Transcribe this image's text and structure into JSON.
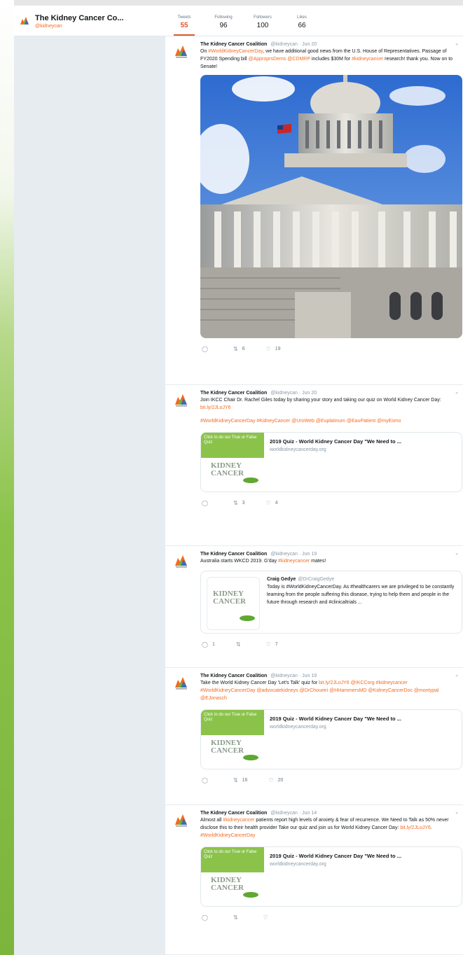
{
  "profile": {
    "name": "The Kidney Cancer Co...",
    "handle": "@kidneycan"
  },
  "stats": [
    {
      "label": "Tweets",
      "value": "55"
    },
    {
      "label": "Following",
      "value": "96"
    },
    {
      "label": "Followers",
      "value": "100"
    },
    {
      "label": "Likes",
      "value": "66"
    }
  ],
  "tweets": [
    {
      "name": "The Kidney Cancer Coalition",
      "meta": "@kidneycan · Jun 20",
      "text": [
        {
          "t": "On "
        },
        {
          "t": "#WorldKidneyCancerDay",
          "hl": true
        },
        {
          "t": ", we have additional good news from the U.S. House of Representatives. Passage of FY2020 Spending bill "
        },
        {
          "t": "@ApproprsDems",
          "hl": true
        },
        {
          "t": " "
        },
        {
          "t": "@CDMRP",
          "hl": true
        },
        {
          "t": " includes $30M for "
        },
        {
          "t": "#kidneycancer",
          "hl": true
        },
        {
          "t": " research! thank you. Now on to Senate!"
        }
      ],
      "actions": {
        "reply": "",
        "retweet": "6",
        "like": "19"
      }
    },
    {
      "name": "The Kidney Cancer Coalition",
      "meta": "@kidneycan · Jun 20",
      "text": [
        {
          "t": "Join IKCC Chair Dr. Rachel Giles today by sharing your story and taking our quiz on World Kidney Cancer Day: "
        },
        {
          "t": "bit.ly/2JLoJY6",
          "hl": true
        }
      ],
      "text2": "#WorldKidneyCancerDay #KidneyCancer @UroWeb @Euplatinum @EauPatient @myEsmo",
      "card": {
        "title": "2019 Quiz - World Kidney Cancer Day \"We Need to ...",
        "domain": "worldkidneycancerday.org",
        "thumb_text": "Click to do our True or False Quiz",
        "thumb_word1": "KIDNEY",
        "thumb_word2": "CANCER"
      },
      "actions": {
        "reply": "",
        "retweet": "3",
        "like": "4"
      }
    },
    {
      "name": "The Kidney Cancer Coalition",
      "meta": "@kidneycan · Jun 19",
      "text": [
        {
          "t": "Australia starts WKCD 2019. G'day "
        },
        {
          "t": "#kidneycancer",
          "hl": true
        },
        {
          "t": " mates!"
        }
      ],
      "quote": {
        "name": "Craig Gedye",
        "handle": "@DrCraigGedye",
        "text": "Today is #WorldKidneyCancerDay. As #healthcarers we are privileged to be constantly learning from the people suffering this disease, trying to help them and people in the future through research and #clinicaltrials ...",
        "thumb_word1": "KIDNEY",
        "thumb_word2": "CANCER"
      },
      "actions": {
        "reply": "1",
        "retweet": "",
        "like": "7"
      }
    },
    {
      "name": "The Kidney Cancer Coalition",
      "meta": "@kidneycan · Jun 19",
      "text": [
        {
          "t": "Take the World Kidney Cancer Day 'Let's Talk' quiz for "
        },
        {
          "t": "bit.ly/2JLoJY6",
          "hl": true
        },
        {
          "t": " "
        },
        {
          "t": "@IKCCorg #kidneycancer #WorldKidneyCancerDay @advocatekidneys @DrChoueiri @HHammersMD @KidneyCancerDoc @montypal @EJonasch",
          "hl": true
        }
      ],
      "card": {
        "title": "2019 Quiz - World Kidney Cancer Day \"We Need to ...",
        "domain": "worldkidneycancerday.org",
        "thumb_text": "Click to do our True or False Quiz",
        "thumb_word1": "KIDNEY",
        "thumb_word2": "CANCER"
      },
      "actions": {
        "reply": "",
        "retweet": "16",
        "like": "20"
      }
    },
    {
      "name": "The Kidney Cancer Coalition",
      "meta": "@kidneycan · Jun 14",
      "text": [
        {
          "t": "Almost all "
        },
        {
          "t": "#kidneycancer",
          "hl": true
        },
        {
          "t": " patients report high levels of anxiety & fear of recurrence. We Need to Talk as 50% never disclose this to their health provider Take our quiz and join us for World Kidney Cancer Day: "
        },
        {
          "t": "bit.ly/2JLoJY6",
          "hl": true
        },
        {
          "t": ". "
        },
        {
          "t": "#WorldKidneyCancerDay",
          "hl": true
        }
      ],
      "card": {
        "title": "2019 Quiz - World Kidney Cancer Day \"We Need to ...",
        "domain": "worldkidneycancerday.org",
        "thumb_text": "Click to do our True or False Quiz",
        "thumb_word1": "KIDNEY",
        "thumb_word2": "CANCER"
      },
      "actions": {
        "reply": "",
        "retweet": "",
        "like": ""
      }
    }
  ],
  "colors": {
    "accent": "#f56a1f",
    "active_tab": "#e0582a",
    "sidebar_bg": "#e6ecf0",
    "green": "#8bc34a"
  },
  "icons": {
    "reply": "reply-icon",
    "retweet": "retweet-icon",
    "like": "like-icon",
    "chevron": "chevron-down-icon"
  }
}
